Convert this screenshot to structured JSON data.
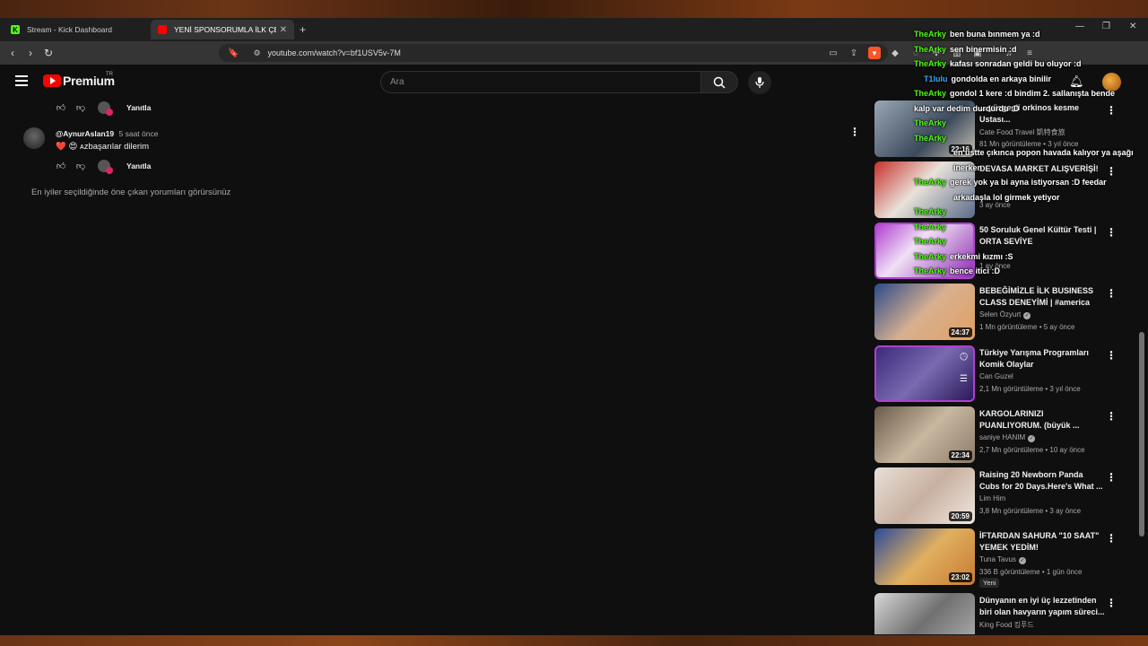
{
  "browser": {
    "tabs": [
      {
        "title": "Stream - Kick Dashboard",
        "favicon": "kick-logo-icon",
        "active": false
      },
      {
        "title": "YENİ SPONSORUMLA İLK ÇEKİM",
        "favicon": "youtube-icon",
        "active": true
      }
    ],
    "new_tab": "+",
    "url": "youtube.com/watch?v=bf1USV5v-7M"
  },
  "youtube": {
    "logo_text": "Premium",
    "logo_region": "TR",
    "search_placeholder": "Ara"
  },
  "comments": {
    "reply_label": "Yanıtla",
    "comment": {
      "handle": "@AynurAslan19",
      "time": "5 saat önce",
      "text": "❤️ 😍 ᴀᴢbaşarılar dilerim"
    },
    "note": "En iyiler seçildiğinde öne çıkan yorumları görürsünüz"
  },
  "videos": [
    {
      "title": "... yüzgeçli orkinos kesme Ustası...",
      "channel": "Cate Food Travel 凱特食旅",
      "verified": false,
      "views": "81 Mn görüntüleme",
      "age": "3 yıl önce",
      "duration": "22:16",
      "thumb": "tuna"
    },
    {
      "title": "DEVASA MARKET ALIŞVERİŞİ!",
      "channel": "",
      "verified": false,
      "views": "",
      "age": "3 ay önce",
      "duration": "",
      "thumb": "market"
    },
    {
      "title": "50 Soruluk Genel Kültür Testi | ORTA SEVİYE",
      "channel": "",
      "verified": false,
      "views": "",
      "age": "1 ay önce",
      "duration": "",
      "thumb": "quiz"
    },
    {
      "title": "BEBEĞİMİZLE İLK BUSINESS CLASS DENEYİMİ | #america",
      "channel": "Selen Özyurt",
      "verified": true,
      "views": "1 Mn görüntüleme",
      "age": "5 ay önce",
      "duration": "24:37",
      "thumb": "flight"
    },
    {
      "title": "Türkiye Yarışma Programları Komik Olaylar",
      "channel": "Can Guzel",
      "verified": false,
      "views": "2,1 Mn görüntüleme",
      "age": "3 yıl önce",
      "duration": "",
      "thumb": "tv"
    },
    {
      "title": "KARGOLARINIZI PUANLIYORUM. (büyük ...",
      "channel": "saniye HANIM",
      "verified": true,
      "views": "2,7 Mn görüntüleme",
      "age": "10 ay önce",
      "duration": "22:34",
      "thumb": "cargo"
    },
    {
      "title": "Raising 20 Newborn Panda Cubs for 20 Days.Here's What ...",
      "channel": "Lim Him",
      "verified": false,
      "views": "3,8 Mn görüntüleme",
      "age": "3 ay önce",
      "duration": "20:59",
      "thumb": "panda"
    },
    {
      "title": "İFTARDAN SAHURA \"10 SAAT\" YEMEK YEDİM!",
      "channel": "Tuna Tavus",
      "verified": true,
      "views": "336 B görüntüleme",
      "age": "1 gün önce",
      "duration": "23:02",
      "badge": "Yeni",
      "thumb": "food"
    },
    {
      "title": "Dünyanın en iyi üç lezzetinden biri olan havyarın yapım süreci...",
      "channel": "King Food 킹푸드",
      "verified": false,
      "views": "",
      "age": "",
      "duration": "",
      "thumb": "fish"
    }
  ],
  "chat": [
    {
      "user": "TheArky",
      "color": "green",
      "msg": "ben buna bınmem ya :d"
    },
    {
      "user": "TheArky",
      "color": "green",
      "msg": "sen binermisin :d"
    },
    {
      "user": "TheArky",
      "color": "green",
      "msg": "kafası sonradan geldi bu oluyor :d"
    },
    {
      "user": "T1lulu",
      "color": "blue",
      "msg": "gondolda en arkaya binilir"
    },
    {
      "user": "TheArky",
      "color": "green",
      "msg": "gondol 1 kere :d bindim 2. sallanışta bende"
    },
    {
      "user": "",
      "color": "none",
      "msg": "kalp var dedim durdurdu :D"
    },
    {
      "user": "TheArky",
      "color": "green",
      "msg": ""
    },
    {
      "user": "TheArky",
      "color": "green",
      "msg": ""
    },
    {
      "user": "",
      "color": "none",
      "msg": "en üstte çıkınca popon havada kalıyor ya aşağı"
    },
    {
      "user": "",
      "color": "none",
      "msg": "inerken"
    },
    {
      "user": "TheArky",
      "color": "green",
      "msg": "gerek yok ya bi ayna istiyorsan :D feedar"
    },
    {
      "user": "",
      "color": "none",
      "msg": "arkadaşla lol girmek yetiyor"
    },
    {
      "user": "TheArky",
      "color": "green",
      "msg": ""
    },
    {
      "user": "TheArky",
      "color": "green",
      "msg": ""
    },
    {
      "user": "TheArky",
      "color": "green",
      "msg": ""
    },
    {
      "user": "TheArky",
      "color": "green",
      "msg": "erkekmi kızmı :S"
    },
    {
      "user": "TheArky",
      "color": "green",
      "msg": "bence itici :D"
    }
  ],
  "colors": {
    "kick_green": "#53fc18",
    "youtube_red": "#ff0000",
    "chat_blue": "#3ea6ff",
    "background": "#0f0f0f"
  }
}
